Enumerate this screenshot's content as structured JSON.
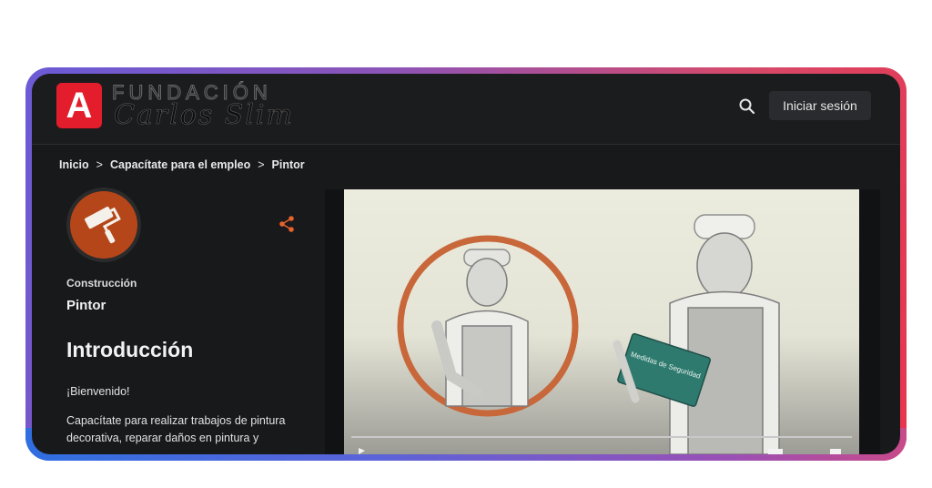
{
  "header": {
    "logo_letter": "A",
    "logo_line1": "FUNDACIÓN",
    "logo_line2": "Carlos Slim",
    "search_icon": "search-icon",
    "login_label": "Iniciar sesión"
  },
  "breadcrumb": [
    "Inicio",
    "Capacítate para el empleo",
    "Pintor"
  ],
  "course": {
    "category": "Construcción",
    "name": "Pintor",
    "badge_icon": "paint-roller-icon",
    "share_icon": "share-icon"
  },
  "content": {
    "section_title": "Introducción",
    "welcome": "¡Bienvenido!",
    "description": "Capacítate para realizar trabajos de pintura decorativa, reparar daños en pintura y"
  },
  "video": {
    "book_title": "Medidas de Seguridad"
  },
  "colors": {
    "accent": "#e8612c",
    "logo_red": "#e31d2b",
    "badge": "#b5461a"
  }
}
